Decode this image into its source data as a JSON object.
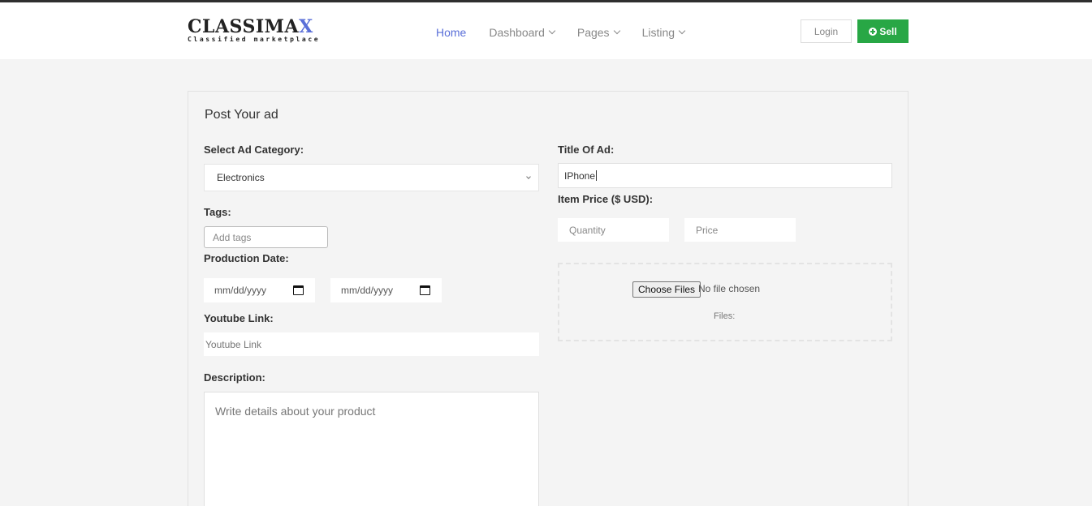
{
  "brand": {
    "name_main": "CLASSIMA",
    "name_accent": "X",
    "tagline": "Classified marketplace",
    "accent_color": "#5a6fd8"
  },
  "nav": {
    "items": [
      {
        "label": "Home",
        "active": true
      },
      {
        "label": "Dashboard",
        "dropdown": true
      },
      {
        "label": "Pages",
        "dropdown": true
      },
      {
        "label": "Listing",
        "dropdown": true
      }
    ]
  },
  "header_actions": {
    "login_label": "Login",
    "sell_label": "Sell",
    "sell_color": "#28a745"
  },
  "form": {
    "title": "Post Your ad",
    "category": {
      "label": "Select Ad Category:",
      "value": "Electronics"
    },
    "tags": {
      "label": "Tags:",
      "placeholder": "Add tags"
    },
    "production_date": {
      "label": "Production Date:",
      "from_placeholder": "mm/dd/yyyy",
      "to_placeholder": "mm/dd/yyyy"
    },
    "youtube": {
      "label": "Youtube Link:",
      "placeholder": "Youtube Link"
    },
    "description": {
      "label": "Description:",
      "placeholder": "Write details about your product"
    },
    "ad_title": {
      "label": "Title Of Ad:",
      "value": "IPhone"
    },
    "price": {
      "label": "Item Price ($ USD):",
      "quantity_placeholder": "Quantity",
      "price_placeholder": "Price"
    },
    "upload": {
      "button_label": "Choose Files",
      "status": "No file chosen",
      "files_label": "Files:"
    }
  }
}
